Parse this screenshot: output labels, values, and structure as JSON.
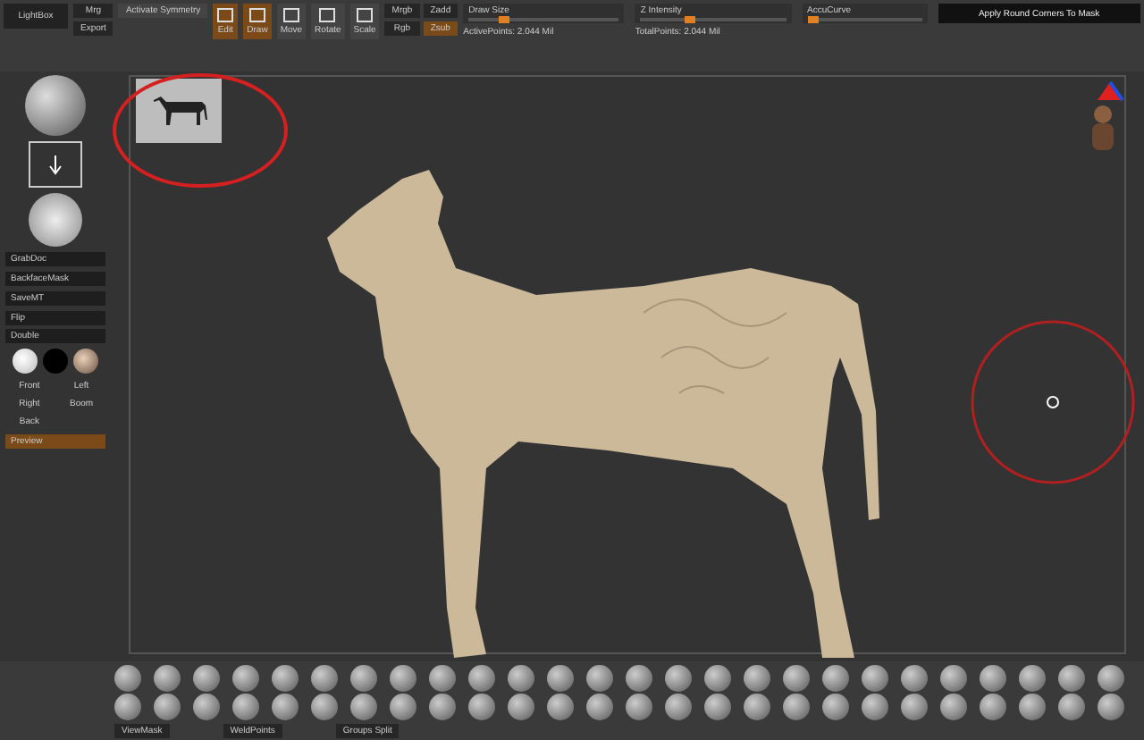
{
  "top_bar": {
    "lightbox": "LightBox",
    "left_buttons": [
      "Mrg",
      "Export"
    ],
    "symmetry": "Activate Symmetry",
    "modes": [
      {
        "label": "Edit",
        "selected": true
      },
      {
        "label": "Draw",
        "selected": true
      },
      {
        "label": "Move",
        "selected": false
      },
      {
        "label": "Rotate",
        "selected": false
      },
      {
        "label": "Scale",
        "selected": false
      }
    ],
    "blend": [
      {
        "label": "Mrgb",
        "selected": false
      },
      {
        "label": "Zadd",
        "selected": false
      },
      {
        "label": "Rgb",
        "selected": false
      },
      {
        "label": "Zsub",
        "selected": true
      }
    ],
    "sliders": [
      {
        "label": "Draw Size",
        "level": 0.2
      },
      {
        "label": "Z Intensity",
        "level": 0.3
      },
      {
        "label": "AccuCurve",
        "level": 0.0
      }
    ],
    "mask_button": "Apply Round Corners To Mask",
    "active_points": "ActivePoints: 2.044 Mil",
    "total_points": "TotalPoints: 2.044 Mil"
  },
  "left_panel": {
    "tools": [
      "GrabDoc",
      "BackfaceMask",
      "SaveMT"
    ],
    "toggles": [
      "Flip",
      "Double"
    ],
    "views": [
      "Front",
      "Left",
      "Right",
      "Boom",
      "Back"
    ],
    "preview": "Preview"
  },
  "bottom_bar": {
    "labels": [
      "ViewMask",
      "WeldPoints",
      "Groups Split"
    ]
  }
}
